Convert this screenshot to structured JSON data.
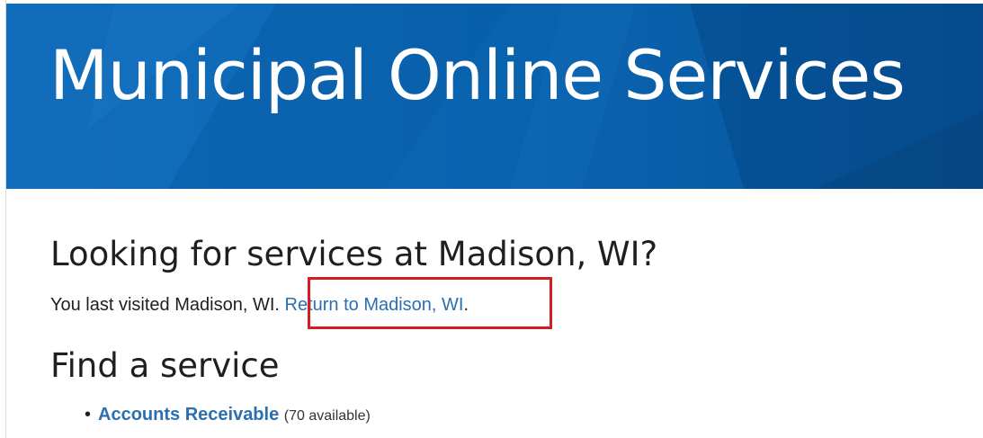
{
  "banner": {
    "title": "Municipal Online Services"
  },
  "location_prompt": {
    "heading": "Looking for services at Madison, WI?",
    "last_visited_text": "You last visited Madison, WI.",
    "return_link_label": "Return to Madison, WI",
    "trailing_period": "."
  },
  "find_service": {
    "heading": "Find a service",
    "items": [
      {
        "bullet": "•",
        "label": "Accounts Receivable",
        "count_text": "(70 available)"
      }
    ]
  },
  "colors": {
    "banner_blue": "#0a63ae",
    "link_blue": "#2a6fb0",
    "highlight_red": "#d21f26"
  },
  "icons": {
    "list_bullet": "bullet-icon"
  }
}
